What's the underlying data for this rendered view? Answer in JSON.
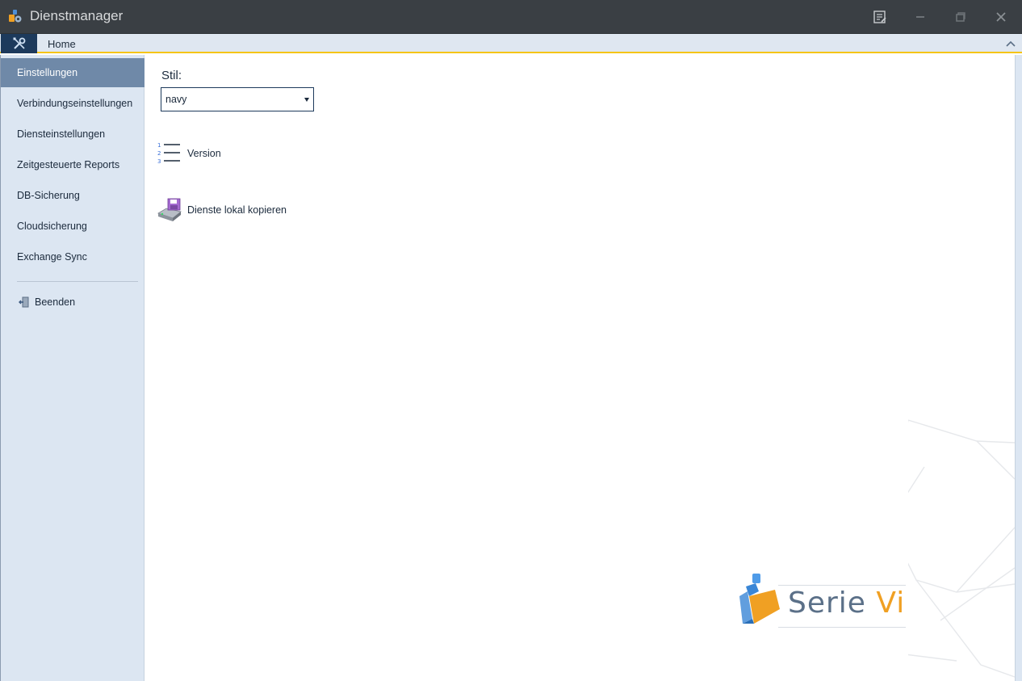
{
  "window": {
    "title": "Dienstmanager"
  },
  "ribbon": {
    "home_tab": "Home"
  },
  "sidebar": {
    "items": [
      {
        "label": "Einstellungen",
        "active": true
      },
      {
        "label": "Verbindungseinstellungen",
        "active": false
      },
      {
        "label": "Diensteinstellungen",
        "active": false
      },
      {
        "label": "Zeitgesteuerte Reports",
        "active": false
      },
      {
        "label": "DB-Sicherung",
        "active": false
      },
      {
        "label": "Cloudsicherung",
        "active": false
      },
      {
        "label": "Exchange Sync",
        "active": false
      }
    ],
    "exit_label": "Beenden"
  },
  "main": {
    "style_label": "Stil:",
    "style_value": "navy",
    "actions": [
      {
        "label": "Version",
        "icon": "numbered-list-icon"
      },
      {
        "label": "Dienste lokal kopieren",
        "icon": "disk-copy-icon"
      }
    ]
  },
  "logo": {
    "text_main": "Serie ",
    "text_accent": "Vi"
  },
  "colors": {
    "titlebar": "#3a3f44",
    "ribbon_accent": "#f5c518",
    "sidebar_bg": "#dce6f2",
    "sidebar_active": "#6f89a8",
    "file_tab": "#1d3a5c",
    "logo_accent": "#f0a023"
  }
}
